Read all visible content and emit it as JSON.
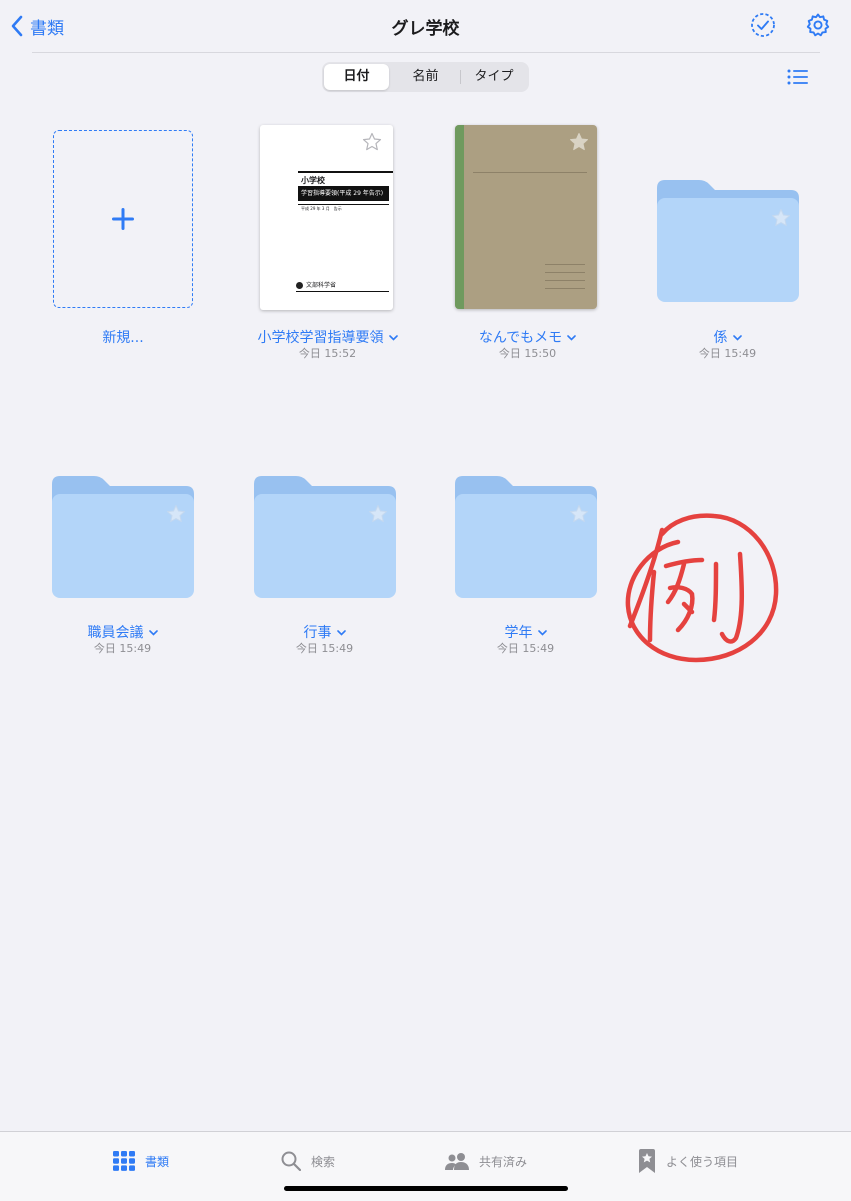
{
  "header": {
    "back_label": "書類",
    "title": "グレ学校"
  },
  "sort": {
    "segments": [
      "日付",
      "名前",
      "タイプ"
    ],
    "selected": "日付"
  },
  "items": [
    {
      "name": "新規...",
      "type": "new"
    },
    {
      "name": "小学校学習指導要領",
      "date": "今日 15:52",
      "type": "document"
    },
    {
      "name": "なんでもメモ",
      "date": "今日 15:50",
      "type": "notebook"
    },
    {
      "name": "係",
      "date": "今日 15:49",
      "type": "folder"
    },
    {
      "name": "職員会議",
      "date": "今日 15:49",
      "type": "folder"
    },
    {
      "name": "行事",
      "date": "今日 15:49",
      "type": "folder"
    },
    {
      "name": "学年",
      "date": "今日 15:49",
      "type": "folder"
    }
  ],
  "doc_cover": {
    "title": "小学校",
    "band": "学習指導要領(平成 29 年告示)",
    "date": "平成 29 年 3 月　告示",
    "publisher": "文部科学省"
  },
  "annotation": {
    "text": "例"
  },
  "tabbar": {
    "tabs": [
      {
        "label": "書類",
        "icon": "grid-icon",
        "active": true
      },
      {
        "label": "検索",
        "icon": "search-icon"
      },
      {
        "label": "共有済み",
        "icon": "people-icon"
      },
      {
        "label": "よく使う項目",
        "icon": "bookmark-star-icon"
      }
    ]
  },
  "colors": {
    "accent": "#2f7bf5",
    "folder": "#b3d5f9",
    "folder_tab": "#98c1f0",
    "notebook": "#ac9f82",
    "notebook_spine": "#6f9a5e",
    "annotation": "#e5423f",
    "background": "#f2f2f7"
  }
}
